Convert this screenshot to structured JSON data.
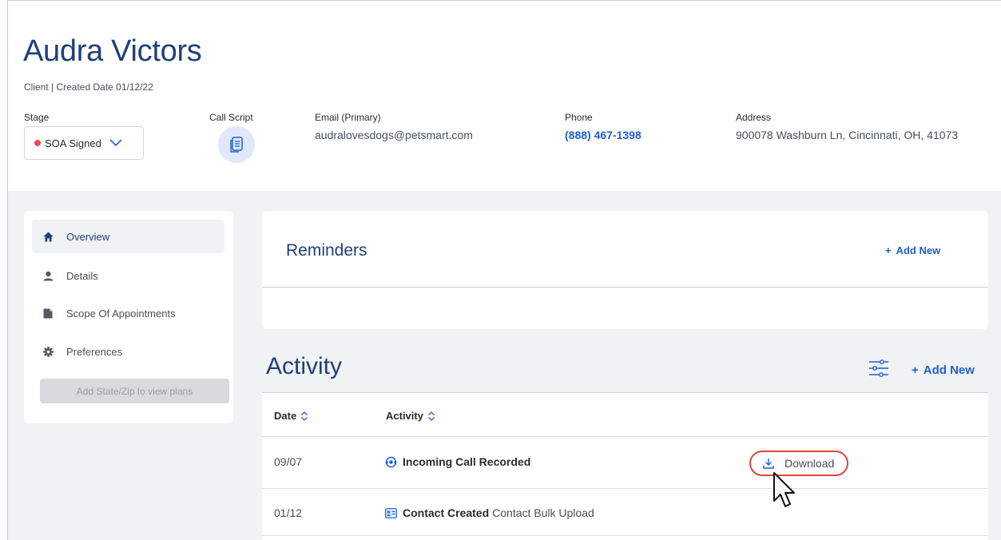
{
  "client": {
    "name": "Audra Victors",
    "subtitle": "Client | Created Date 01/12/22"
  },
  "fields": {
    "stage_label": "Stage",
    "stage_value": "SOA Signed",
    "call_script_label": "Call Script",
    "email_label": "Email (Primary)",
    "email_value": "audralovesdogs@petsmart.com",
    "phone_label": "Phone",
    "phone_value": "(888) 467-1398",
    "address_label": "Address",
    "address_value": "900078 Washburn Ln, Cincinnati, OH, 41073"
  },
  "sidebar": {
    "items": [
      {
        "label": "Overview",
        "icon": "home-icon",
        "active": true
      },
      {
        "label": "Details",
        "icon": "user-icon",
        "active": false
      },
      {
        "label": "Scope Of Appointments",
        "icon": "file-icon",
        "active": false
      },
      {
        "label": "Preferences",
        "icon": "gear-icon",
        "active": false
      }
    ],
    "plans_button": "Add State/Zip to view plans"
  },
  "reminders": {
    "title": "Reminders",
    "add_new": "Add New"
  },
  "activity": {
    "title": "Activity",
    "add_new": "Add New",
    "columns": [
      "Date",
      "Activity"
    ],
    "rows": [
      {
        "date": "09/07",
        "title": "Incoming Call Recorded",
        "detail": "",
        "icon": "call-recording-icon",
        "action": "Download"
      },
      {
        "date": "01/12",
        "title": "Contact Created",
        "detail": "Contact Bulk Upload",
        "icon": "contact-card-icon",
        "action": ""
      }
    ]
  },
  "colors": {
    "brand_navy": "#1f3f7a",
    "link_blue": "#1f5fd6",
    "stage_red": "#e94f4f",
    "highlight_red": "#e0453b"
  }
}
